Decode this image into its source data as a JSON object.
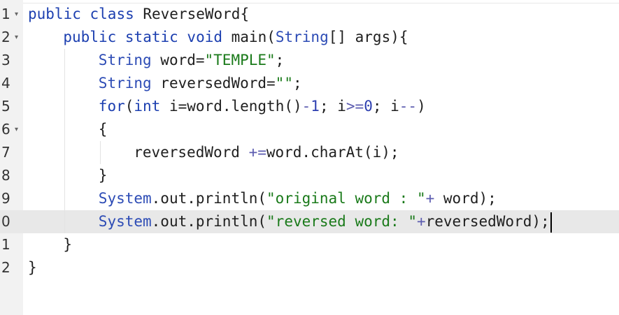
{
  "editor": {
    "language": "java",
    "cursor": {
      "line": "0"
    },
    "lines": [
      {
        "num": "1",
        "fold": true,
        "indent": 0,
        "tokens": [
          [
            "kw",
            "public"
          ],
          [
            "",
            " "
          ],
          [
            "kw",
            "class"
          ],
          [
            "",
            " ReverseWord{"
          ]
        ]
      },
      {
        "num": "2",
        "fold": true,
        "indent": 1,
        "tokens": [
          [
            "kw",
            "public"
          ],
          [
            "",
            " "
          ],
          [
            "kw",
            "static"
          ],
          [
            "",
            " "
          ],
          [
            "kw",
            "void"
          ],
          [
            "",
            " main("
          ],
          [
            "ty",
            "String"
          ],
          [
            "",
            "[] args){"
          ]
        ]
      },
      {
        "num": "3",
        "fold": false,
        "indent": 2,
        "tokens": [
          [
            "ty",
            "String"
          ],
          [
            "",
            " word="
          ],
          [
            "str",
            "\"TEMPLE\""
          ],
          [
            "",
            ";"
          ]
        ]
      },
      {
        "num": "4",
        "fold": false,
        "indent": 2,
        "tokens": [
          [
            "ty",
            "String"
          ],
          [
            "",
            " reversedWord="
          ],
          [
            "str",
            "\"\""
          ],
          [
            "",
            ";"
          ]
        ]
      },
      {
        "num": "5",
        "fold": false,
        "indent": 2,
        "tokens": [
          [
            "kw",
            "for"
          ],
          [
            "",
            "("
          ],
          [
            "kw",
            "int"
          ],
          [
            "",
            " i="
          ],
          [
            "",
            "word.length()"
          ],
          [
            "op",
            "-"
          ],
          [
            "num",
            "1"
          ],
          [
            "",
            "; i"
          ],
          [
            "op",
            ">="
          ],
          [
            "num",
            "0"
          ],
          [
            "",
            "; i"
          ],
          [
            "op",
            "--"
          ],
          [
            "",
            ")"
          ]
        ]
      },
      {
        "num": "6",
        "fold": true,
        "indent": 2,
        "tokens": [
          [
            "",
            "{"
          ]
        ]
      },
      {
        "num": "7",
        "fold": false,
        "indent": 3,
        "tokens": [
          [
            "",
            "reversedWord "
          ],
          [
            "op",
            "+="
          ],
          [
            "",
            "word.charAt(i);"
          ]
        ]
      },
      {
        "num": "8",
        "fold": false,
        "indent": 2,
        "tokens": [
          [
            "",
            "}"
          ]
        ]
      },
      {
        "num": "9",
        "fold": false,
        "indent": 2,
        "tokens": [
          [
            "ty",
            "System"
          ],
          [
            "",
            ".out.println("
          ],
          [
            "str",
            "\"original word : \""
          ],
          [
            "op",
            "+"
          ],
          [
            "",
            " word);"
          ]
        ]
      },
      {
        "num": "0",
        "fold": false,
        "indent": 2,
        "active": true,
        "tokens": [
          [
            "ty",
            "System"
          ],
          [
            "",
            ".out.println("
          ],
          [
            "str",
            "\"reversed word: \""
          ],
          [
            "op",
            "+"
          ],
          [
            "",
            "reversedWord);"
          ]
        ]
      },
      {
        "num": "1",
        "fold": false,
        "indent": 1,
        "tokens": [
          [
            "",
            "}"
          ]
        ]
      },
      {
        "num": "2",
        "fold": false,
        "indent": 0,
        "tokens": [
          [
            "",
            "}"
          ]
        ]
      }
    ]
  },
  "colors": {
    "keyword": "#1c3fb0",
    "type": "#2c4bb5",
    "string": "#1a7a1a",
    "number": "#2d3fb0",
    "operator": "#5c5cb0",
    "active_line": "#e8e8e8",
    "gutter": "#f2f2f2"
  },
  "icons": {
    "fold": "chevron-down-icon"
  }
}
